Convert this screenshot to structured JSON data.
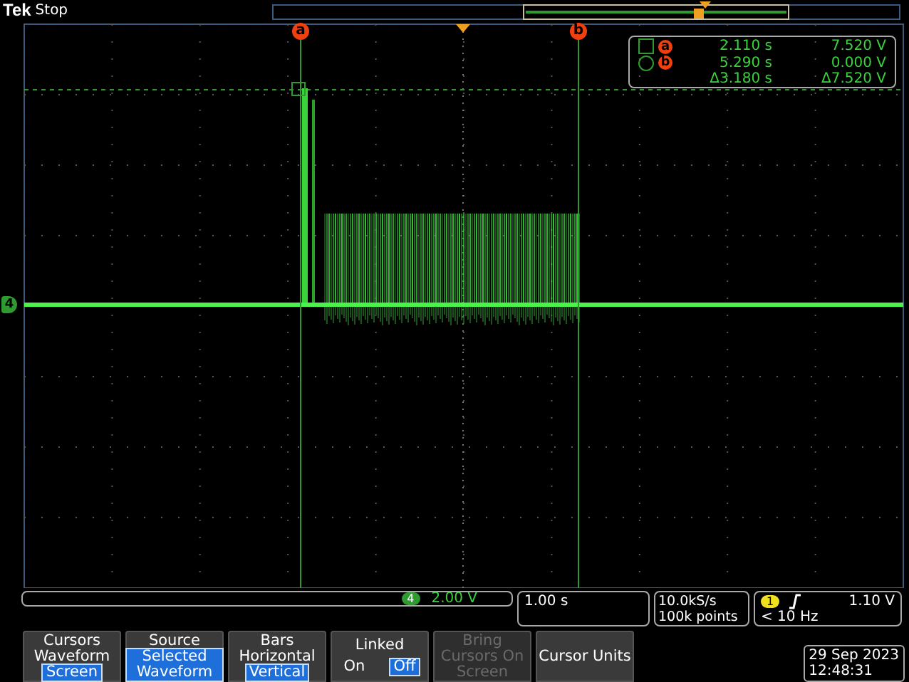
{
  "status": {
    "brand": "Tek",
    "state": "Stop"
  },
  "cursor_markers": [
    {
      "label": "a"
    },
    {
      "label": "b"
    }
  ],
  "ground_marker": "4",
  "readout": {
    "rows": [
      {
        "label": "a",
        "time": "2.110 s",
        "voltage": "7.520 V"
      },
      {
        "label": "b",
        "time": "5.290 s",
        "voltage": "0.000 V"
      }
    ],
    "delta_time": "Δ3.180 s",
    "delta_voltage": "Δ7.520 V"
  },
  "channel": {
    "number": "4",
    "scale": "2.00 V"
  },
  "timebase": "1.00 s",
  "acquisition": {
    "rate": "10.0kS/s",
    "record": "100k points"
  },
  "trigger": {
    "channel": "1",
    "level": "1.10 V",
    "frequency": "< 10 Hz"
  },
  "menu": [
    {
      "kind": "stack",
      "title": "Cursors",
      "disabled": false,
      "options": [
        {
          "label": "Waveform",
          "selected": false
        },
        {
          "label": "Screen",
          "selected": true
        }
      ]
    },
    {
      "kind": "stack",
      "title": "Source",
      "disabled": false,
      "options": [
        {
          "label": "Selected Waveform",
          "selected": true
        }
      ]
    },
    {
      "kind": "stack",
      "title": "Bars",
      "disabled": false,
      "options": [
        {
          "label": "Horizontal",
          "selected": false
        },
        {
          "label": "Vertical",
          "selected": true
        }
      ]
    },
    {
      "kind": "toggle",
      "title": "Linked",
      "disabled": false,
      "options": [
        {
          "label": "On",
          "selected": false
        },
        {
          "label": "Off",
          "selected": true
        }
      ]
    },
    {
      "kind": "plain",
      "title": "Bring Cursors On Screen",
      "disabled": true
    },
    {
      "kind": "plain",
      "title": "Cursor Units",
      "disabled": false
    }
  ],
  "clock": {
    "date": "29 Sep  2023",
    "time": "12:48:31"
  }
}
